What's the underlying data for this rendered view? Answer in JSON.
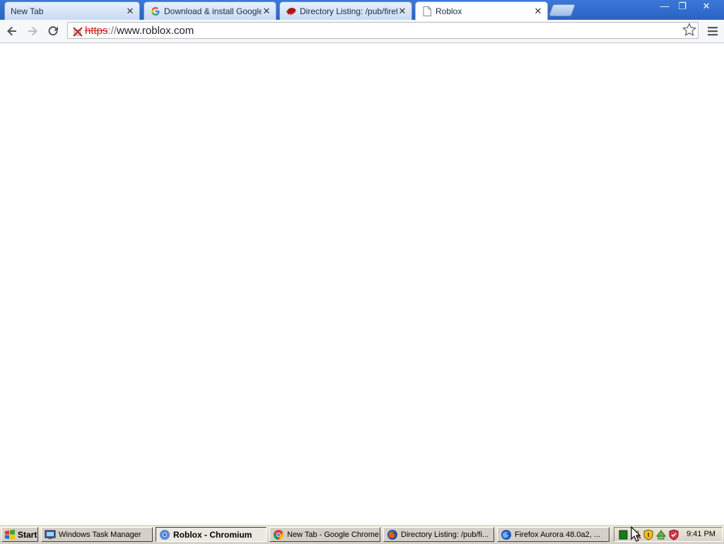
{
  "window": {
    "controls": {
      "minimize": "—",
      "restore": "❐",
      "close": "✕"
    }
  },
  "tabs": [
    {
      "title": "New Tab",
      "close": "✕",
      "icon": "no-icon",
      "active": false
    },
    {
      "title": "Download & install Google Ch",
      "close": "✕",
      "icon": "google-g-icon",
      "active": false
    },
    {
      "title": "Directory Listing: /pub/firefo",
      "close": "✕",
      "icon": "mozilla-dino-icon",
      "active": false
    },
    {
      "title": "Roblox",
      "close": "✕",
      "icon": "page-icon",
      "active": true
    }
  ],
  "toolbar": {
    "url_scheme": "https",
    "url_sep": "://",
    "url_host": "www.roblox.com"
  },
  "taskbar": {
    "start_label": "Start",
    "tasks": [
      {
        "label": "Windows Task Manager",
        "icon": "task-manager-icon",
        "active": false
      },
      {
        "label": "Roblox - Chromium",
        "icon": "chromium-icon",
        "active": true
      },
      {
        "label": "New Tab - Google Chrome",
        "icon": "chrome-icon",
        "active": false
      },
      {
        "label": "Directory Listing: /pub/fi...",
        "icon": "firefox-icon",
        "active": false
      },
      {
        "label": "Firefox Aurora 48.0a2, ...",
        "icon": "firefox-aurora-icon",
        "active": false
      }
    ],
    "clock": "9:41 PM"
  },
  "colors": {
    "titlebar": "#2a63c2",
    "insecure_scheme": "#c8201e",
    "taskbar": "#d4d0c8"
  }
}
